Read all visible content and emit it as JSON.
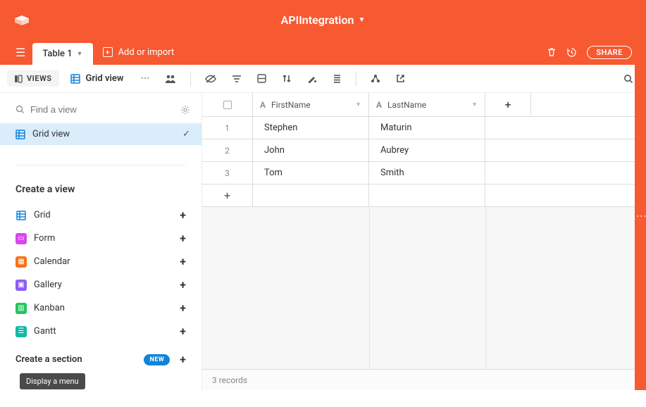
{
  "topbar": {
    "title": "APIIntegration"
  },
  "tabs": {
    "active_tab": "Table 1",
    "add_import": "Add or import",
    "share": "SHARE"
  },
  "toolbar": {
    "views": "VIEWS",
    "grid_view": "Grid view"
  },
  "sidebar": {
    "find_placeholder": "Find a view",
    "active_view": "Grid view",
    "create_view_header": "Create a view",
    "view_types": [
      {
        "label": "Grid",
        "color": "#1283da"
      },
      {
        "label": "Form",
        "color": "#d946ef"
      },
      {
        "label": "Calendar",
        "color": "#f97316"
      },
      {
        "label": "Gallery",
        "color": "#8b5cf6"
      },
      {
        "label": "Kanban",
        "color": "#22c55e"
      },
      {
        "label": "Gantt",
        "color": "#14b8a6"
      }
    ],
    "create_section": "Create a section",
    "new_badge": "NEW"
  },
  "grid": {
    "columns": [
      {
        "name": "FirstName"
      },
      {
        "name": "LastName"
      }
    ],
    "rows": [
      {
        "num": "1",
        "first": "Stephen",
        "last": "Maturin"
      },
      {
        "num": "2",
        "first": "John",
        "last": "Aubrey"
      },
      {
        "num": "3",
        "first": "Tom",
        "last": "Smith"
      }
    ],
    "footer": "3 records"
  },
  "tooltip": "Display a menu"
}
